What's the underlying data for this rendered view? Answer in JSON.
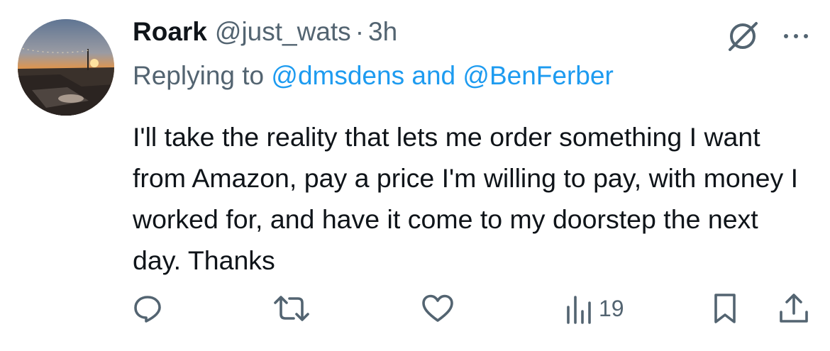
{
  "tweet": {
    "display_name": "Roark",
    "handle": "@just_wats",
    "separator": "·",
    "time": "3h",
    "replying_prefix": "Replying to ",
    "mention_1": "@dmsdens",
    "replying_and": " and ",
    "mention_2": "@BenFerber",
    "text": "I'll take the reality that lets me order something I want from Amazon, pay a price I'm willing to pay, with money I worked for, and have it come to my doorstep the next day. Thanks"
  },
  "actions": {
    "views_count": "19"
  },
  "icons": {
    "top": [
      "grok-icon",
      "more-icon"
    ],
    "bar": [
      "reply-icon",
      "retweet-icon",
      "like-icon",
      "views-icon",
      "bookmark-icon",
      "share-icon"
    ]
  },
  "colors": {
    "text": "#0f1419",
    "secondary": "#536471",
    "link": "#1d9bf0"
  }
}
